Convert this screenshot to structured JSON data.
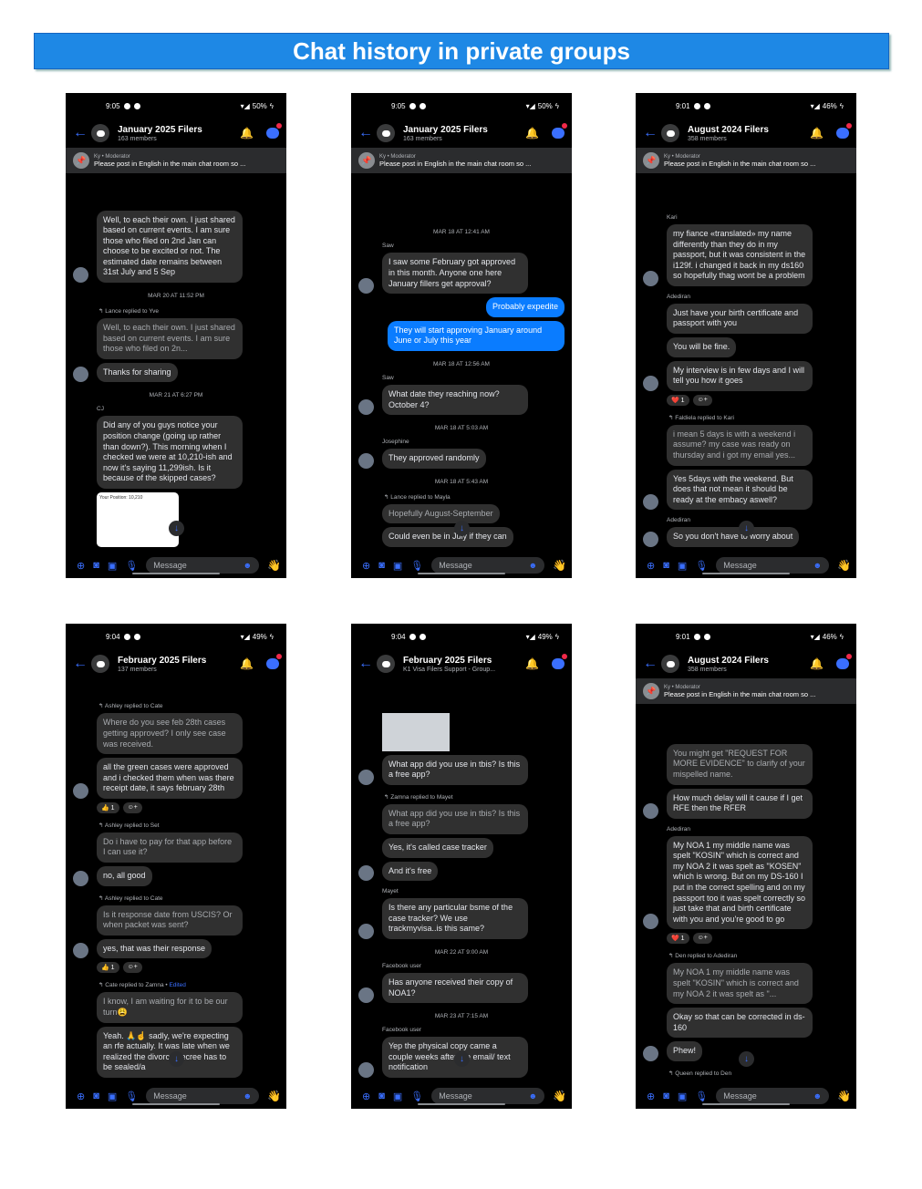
{
  "title": "Chat history in private groups",
  "composer": {
    "placeholder": "Message"
  },
  "phones": [
    {
      "status": {
        "time": "9:05",
        "battery": "50%"
      },
      "header": {
        "name": "January 2025 Filers",
        "sub": "163 members"
      },
      "pinned": {
        "author": "Ky • Moderator",
        "text": "Please post in English in the main chat room so ..."
      },
      "items": [
        {
          "t": "msg",
          "text": "Well, to each their own. I just shared based on current events. I am sure those who filed on 2nd Jan can choose to be excited or not. The estimated date remains between 31st July and 5 Sep",
          "av": true
        },
        {
          "t": "ts",
          "text": "MAR 20 AT 11:52 PM"
        },
        {
          "t": "reply",
          "text": "Lance replied to Yve"
        },
        {
          "t": "msg",
          "text": "Well, to each their own. I just shared based on current events. I am sure those who filed on 2n...",
          "dim": true
        },
        {
          "t": "msg",
          "text": "Thanks for sharing",
          "av": true
        },
        {
          "t": "ts",
          "text": "MAR 21 AT 6:27 PM"
        },
        {
          "t": "sender",
          "text": "CJ"
        },
        {
          "t": "msg",
          "text": "Did any of you guys notice your position change (going up rather than down?). This morning when I checked we were at 10,210-ish and now it's saying 11,299ish. Is it because of the skipped cases?"
        },
        {
          "t": "shot",
          "text": "Your Position: 10,210"
        }
      ]
    },
    {
      "status": {
        "time": "9:05",
        "battery": "50%"
      },
      "header": {
        "name": "January 2025 Filers",
        "sub": "163 members"
      },
      "pinned": {
        "author": "Ky • Moderator",
        "text": "Please post in English in the main chat room so ..."
      },
      "items": [
        {
          "t": "ts",
          "text": "MAR 18 AT 12:41 AM"
        },
        {
          "t": "sender",
          "text": "Saw"
        },
        {
          "t": "msg",
          "text": "I saw some February got approved in this month. Anyone one here January fillers get approval?",
          "av": true
        },
        {
          "t": "me",
          "text": "Probably expedite"
        },
        {
          "t": "me",
          "text": "They will start approving January around June or July this year"
        },
        {
          "t": "ts",
          "text": "MAR 18 AT 12:56 AM"
        },
        {
          "t": "sender",
          "text": "Saw"
        },
        {
          "t": "msg",
          "text": "What date they reaching now? October 4?",
          "av": true
        },
        {
          "t": "ts",
          "text": "MAR 18 AT 5:03 AM"
        },
        {
          "t": "sender",
          "text": "Josephine"
        },
        {
          "t": "msg",
          "text": "They approved randomly",
          "av": true
        },
        {
          "t": "ts",
          "text": "MAR 18 AT 5:43 AM"
        },
        {
          "t": "reply",
          "text": "Lance replied to Mayla"
        },
        {
          "t": "msg",
          "text": "Hopefully August-September",
          "dim": true
        },
        {
          "t": "msg",
          "text": "Could even be in July if they can"
        }
      ]
    },
    {
      "status": {
        "time": "9:01",
        "battery": "46%"
      },
      "header": {
        "name": "August 2024 Filers",
        "sub": "358 members"
      },
      "pinned": {
        "author": "Ky • Moderator",
        "text": "Please post in English in the main chat room so ..."
      },
      "items": [
        {
          "t": "sender",
          "text": "Kari"
        },
        {
          "t": "msg",
          "text": "my fiance «translated» my name differently than they do in my passport, but it was consistent in the i129f. i changed it back in my ds160 so hopefully thag wont be a problem",
          "av": true
        },
        {
          "t": "sender",
          "text": "Adediran"
        },
        {
          "t": "msg",
          "text": "Just have your birth certificate and passport with you"
        },
        {
          "t": "msg",
          "text": "You will be fine."
        },
        {
          "t": "msg",
          "text": "My interview is in few days and I will tell you how it goes",
          "av": true
        },
        {
          "t": "reacts",
          "items": [
            "❤️ 1",
            "☺+"
          ]
        },
        {
          "t": "reply",
          "text": "Faldiela replied to Kari"
        },
        {
          "t": "msg",
          "text": "i mean 5 days is with a weekend i assume? my case was ready on thursday and i got my email yes...",
          "dim": true
        },
        {
          "t": "msg",
          "text": "Yes 5days with the weekend. But does that not mean it should be ready at the embacy aswell?",
          "av": true
        },
        {
          "t": "sender",
          "text": "Adediran"
        },
        {
          "t": "msg",
          "text": "So you don't have to worry about",
          "av": true
        }
      ]
    },
    {
      "status": {
        "time": "9:04",
        "battery": "49%"
      },
      "header": {
        "name": "February 2025 Filers",
        "sub": "137 members"
      },
      "pinned": null,
      "items": [
        {
          "t": "reply",
          "text": "Ashley replied to Cate"
        },
        {
          "t": "msg",
          "text": "Where do you see feb 28th cases getting approved? I only see case was received.",
          "dim": true
        },
        {
          "t": "msg",
          "text": "all the green cases were approved and i checked them when was there receipt date, it says february 28th",
          "av": true
        },
        {
          "t": "reacts",
          "items": [
            "👍 1",
            "☺+"
          ]
        },
        {
          "t": "reply",
          "text": "Ashley replied to Set"
        },
        {
          "t": "msg",
          "text": "Do i have to pay for that app before I can use it?",
          "dim": true
        },
        {
          "t": "msg",
          "text": "no, all good",
          "av": true
        },
        {
          "t": "reply",
          "text": "Ashley replied to Cate"
        },
        {
          "t": "msg",
          "text": "Is it response date from USCIS? Or when packet was sent?",
          "dim": true
        },
        {
          "t": "msg",
          "text": "yes, that was their response",
          "av": true
        },
        {
          "t": "reacts",
          "items": [
            "👍 1",
            "☺+"
          ]
        },
        {
          "t": "reply",
          "text": "Cate replied to Zamna • ",
          "edited": "Edited"
        },
        {
          "t": "msg",
          "text": "I know, I am waiting for it to be our turn😩",
          "dim": true
        },
        {
          "t": "msg",
          "text": "Yeah. 🙏☝ sadly, we're expecting an rfe actually. It was late when we realized the divorce decree has to be sealed/a"
        }
      ]
    },
    {
      "status": {
        "time": "9:04",
        "battery": "49%"
      },
      "header": {
        "name": "February 2025 Filers",
        "sub": "K1 Visa Filers Support - Group..."
      },
      "pinned": null,
      "items": [
        {
          "t": "shot2",
          "text": ""
        },
        {
          "t": "msg",
          "text": "What app did you use in tbis? Is this a free app?",
          "av": true
        },
        {
          "t": "reply",
          "text": "Zamna replied to Mayet"
        },
        {
          "t": "msg",
          "text": "What app did you use in tbis? Is this a free app?",
          "dim": true
        },
        {
          "t": "msg",
          "text": "Yes, it's called case tracker"
        },
        {
          "t": "msg",
          "text": "And it's free",
          "av": true
        },
        {
          "t": "sender",
          "text": "Mayet"
        },
        {
          "t": "msg",
          "text": "Is there any particular bsme of the case tracker?  We use trackmyvisa..is this same?",
          "av": true
        },
        {
          "t": "ts",
          "text": "MAR 22 AT 9:00 AM"
        },
        {
          "t": "sender",
          "text": "Facebook user"
        },
        {
          "t": "msg",
          "text": "Has anyone received their copy of NOA1?",
          "av": true
        },
        {
          "t": "ts",
          "text": "MAR 23 AT 7:15 AM"
        },
        {
          "t": "sender",
          "text": "Facebook user"
        },
        {
          "t": "msg",
          "text": "Yep the physical copy came a couple weeks after the email/ text notification",
          "av": true
        }
      ]
    },
    {
      "status": {
        "time": "9:01",
        "battery": "46%"
      },
      "header": {
        "name": "August 2024 Filers",
        "sub": "358 members"
      },
      "pinned": {
        "author": "Ky • Moderator",
        "text": "Please post in English in the main chat room so ..."
      },
      "items": [
        {
          "t": "msg",
          "text": "You might get \"REQUEST FOR MORE EVIDENCE\" to clarify of your mispelled name.",
          "dim": true
        },
        {
          "t": "msg",
          "text": "How much delay will it cause if I get RFE then the RFER",
          "av": true
        },
        {
          "t": "sender",
          "text": "Adediran"
        },
        {
          "t": "msg",
          "text": "My NOA 1 my middle name was spelt \"KOSIN\" which is correct and my NOA 2 it was spelt as \"KOSEN\" which is wrong. But on my DS-160 I put in the correct spelling and on my passport too it was spelt correctly so just take that and birth certificate with you and you're good to go",
          "av": true
        },
        {
          "t": "reacts",
          "items": [
            "❤️ 1",
            "☺+"
          ]
        },
        {
          "t": "reply",
          "text": "Den replied to Adediran"
        },
        {
          "t": "msg",
          "text": "My NOA 1 my middle name was spelt \"KOSIN\" which is correct and my NOA 2 it was spelt as \"...",
          "dim": true
        },
        {
          "t": "msg",
          "text": "Okay so that can be corrected in ds-160"
        },
        {
          "t": "msg",
          "text": "Phew!",
          "av": true
        },
        {
          "t": "reply",
          "text": "Queen replied to Den"
        }
      ]
    }
  ]
}
